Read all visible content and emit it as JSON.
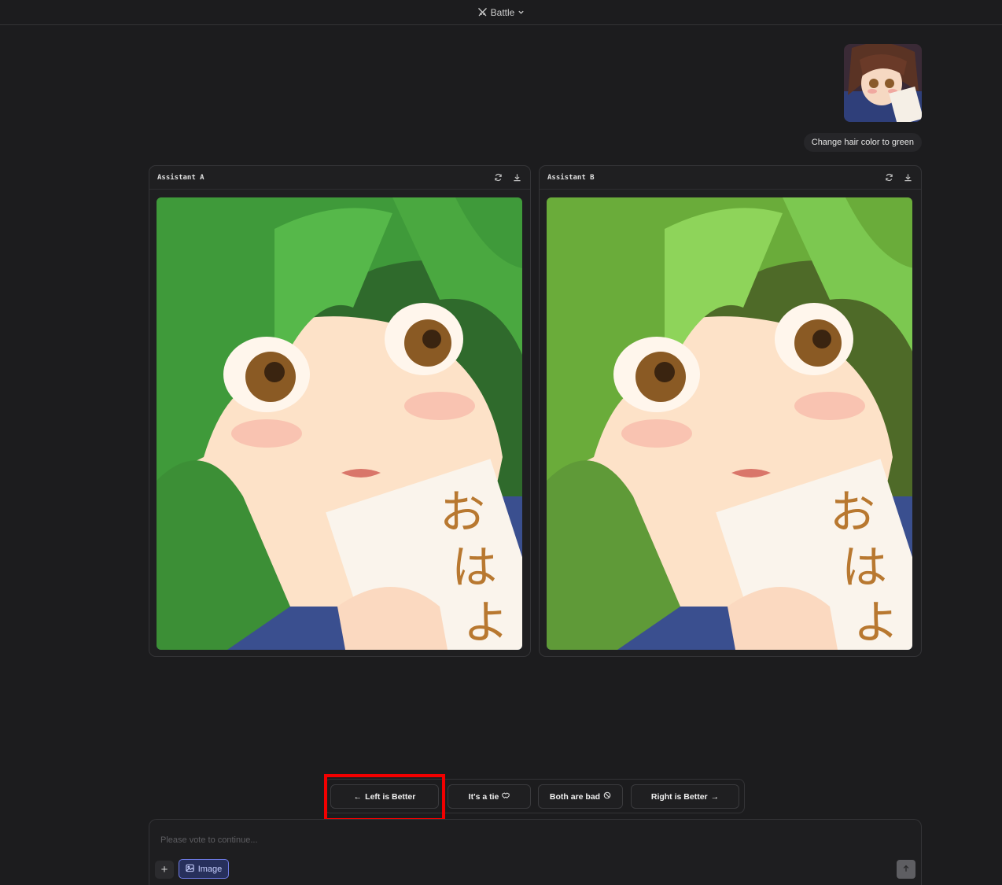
{
  "header": {
    "mode_label": "Battle",
    "mode_icon": "swords-icon"
  },
  "conversation": {
    "user_message": "Change hair color to green",
    "user_image_icon": "uploaded-image-thumbnail"
  },
  "panels": [
    {
      "title": "Assistant A",
      "actions": [
        "regenerate-icon",
        "download-icon"
      ]
    },
    {
      "title": "Assistant B",
      "actions": [
        "regenerate-icon",
        "download-icon"
      ]
    }
  ],
  "vote": {
    "left": "Left is Better",
    "left_arrow": "←",
    "tie": "It's a tie",
    "bad": "Both are bad",
    "right": "Right is Better",
    "right_arrow": "→",
    "highlight_color": "#f20000"
  },
  "composer": {
    "placeholder": "Please vote to continue...",
    "value": "",
    "plus": "+",
    "image_label": "Image",
    "accent": "#6f7ce8"
  }
}
